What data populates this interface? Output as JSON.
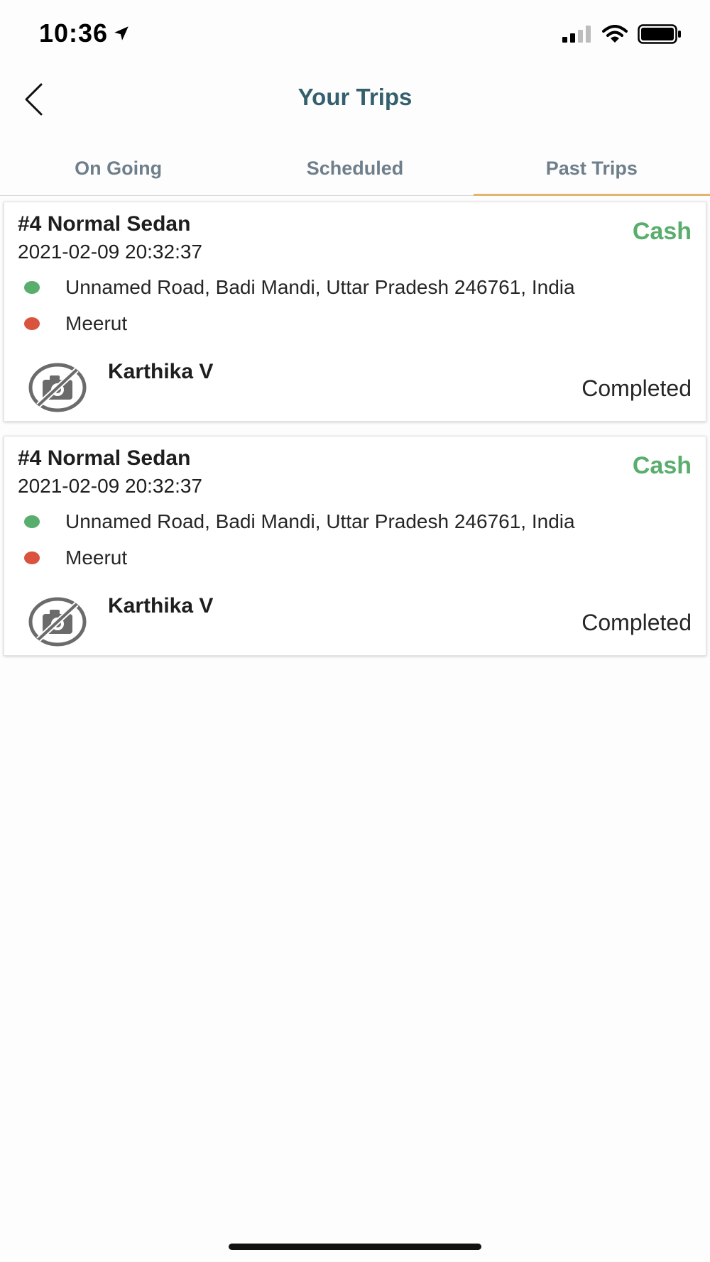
{
  "status_bar": {
    "time": "10:36",
    "icons": [
      "location-arrow-icon",
      "cellular-signal-icon",
      "wifi-icon",
      "battery-icon"
    ]
  },
  "header": {
    "title": "Your Trips",
    "back_icon": "chevron-left-icon"
  },
  "tabs": [
    {
      "label": "On Going",
      "active": false
    },
    {
      "label": "Scheduled",
      "active": false
    },
    {
      "label": "Past Trips",
      "active": true
    }
  ],
  "colors": {
    "title": "#34606e",
    "tab_text": "#6e7f8b",
    "tab_indicator": "#e2b46e",
    "payment": "#59ad6d",
    "pickup_dot": "#59ad6d",
    "drop_dot": "#d9533f"
  },
  "trips": [
    {
      "title": "#4 Normal Sedan",
      "datetime": "2021-02-09 20:32:37",
      "payment": "Cash",
      "pickup": "Unnamed Road, Badi Mandi, Uttar Pradesh 246761, India",
      "drop": "Meerut",
      "driver": "Karthika V",
      "avatar_icon": "no-photo-icon",
      "status": "Completed"
    },
    {
      "title": "#4 Normal Sedan",
      "datetime": "2021-02-09 20:32:37",
      "payment": "Cash",
      "pickup": "Unnamed Road, Badi Mandi, Uttar Pradesh 246761, India",
      "drop": "Meerut",
      "driver": "Karthika V",
      "avatar_icon": "no-photo-icon",
      "status": "Completed"
    }
  ]
}
